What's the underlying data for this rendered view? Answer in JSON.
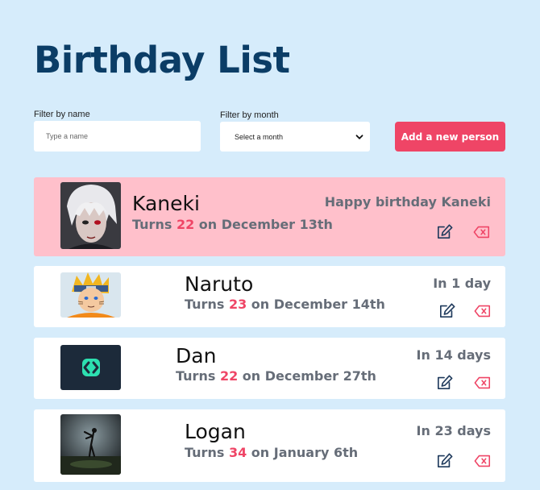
{
  "header": {
    "title": "Birthday List"
  },
  "filters": {
    "name_label": "Filter by name",
    "name_placeholder": "Type a name",
    "month_label": "Filter by month",
    "month_selected": "Select a month"
  },
  "actions": {
    "add_label": "Add a new person"
  },
  "people": [
    {
      "name": "Kaneki",
      "turns_prefix": "Turns",
      "age": "22",
      "date_text": "on December 13th",
      "status": "Happy birthday Kaneki",
      "highlight": true
    },
    {
      "name": "Naruto",
      "turns_prefix": "Turns",
      "age": "23",
      "date_text": "on December 14th",
      "status": "In 1 day",
      "highlight": false
    },
    {
      "name": "Dan",
      "turns_prefix": "Turns",
      "age": "22",
      "date_text": "on December 27th",
      "status": "In 14 days",
      "highlight": false
    },
    {
      "name": "Logan",
      "turns_prefix": "Turns",
      "age": "34",
      "date_text": "on January 6th",
      "status": "In 23 days",
      "highlight": false
    }
  ],
  "colors": {
    "accent": "#ef4566",
    "title": "#0b3d66",
    "background": "#d6ecfb",
    "highlight": "#ffc0cb",
    "edit_icon": "#1f3a5c"
  },
  "icons": {
    "edit": "pencil-square-icon",
    "delete": "backspace-x-icon",
    "select": "chevron-down-icon"
  }
}
